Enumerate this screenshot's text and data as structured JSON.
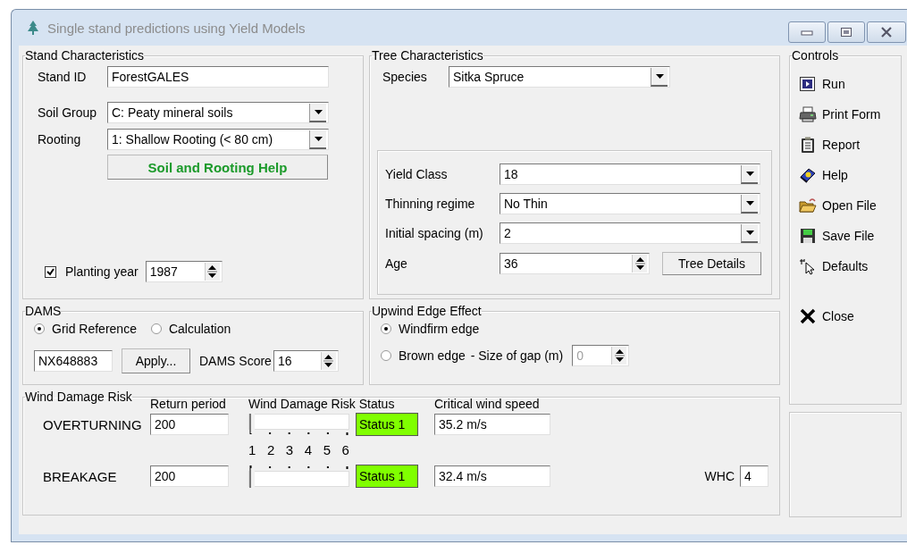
{
  "window": {
    "title": "Single stand predictions using Yield Models"
  },
  "stand_characteristics": {
    "title": "Stand Characteristics",
    "fields": [
      {
        "label": "Stand ID",
        "kind": "text",
        "value": "ForestGALES"
      },
      {
        "label": "Soil Group",
        "kind": "dropdown",
        "value": "C: Peaty mineral soils"
      },
      {
        "label": "Rooting",
        "kind": "dropdown",
        "value": "1: Shallow Rooting (< 80 cm)"
      }
    ],
    "help_button": "Soil and Rooting Help",
    "planting_year": {
      "label": "Planting year",
      "checked": true,
      "value": "1987"
    }
  },
  "tree_characteristics": {
    "title": "Tree Characteristics",
    "species": {
      "label": "Species",
      "value": "Sitka Spruce"
    },
    "fields": [
      {
        "label": "Yield Class",
        "kind": "dropdown",
        "value": "18"
      },
      {
        "label": "Thinning regime",
        "kind": "dropdown",
        "value": "No Thin"
      },
      {
        "label": "Initial spacing (m)",
        "kind": "dropdown",
        "value": "2"
      },
      {
        "label": "Age",
        "kind": "spinner",
        "value": "36"
      }
    ],
    "details_button": "Tree Details"
  },
  "dams": {
    "title": "DAMS",
    "options": [
      {
        "label": "Grid Reference",
        "selected": true
      },
      {
        "label": "Calculation",
        "selected": false
      }
    ],
    "grid_reference": "NX648883",
    "apply_button": "Apply...",
    "score": {
      "label": "DAMS Score",
      "value": "16"
    }
  },
  "upwind_edge_effect": {
    "title": "Upwind Edge Effect",
    "options": [
      {
        "label": "Windfirm edge",
        "selected": true
      },
      {
        "label": "Brown edge",
        "selected": false
      }
    ],
    "gap": {
      "label": "- Size of gap (m)",
      "value": "0",
      "disabled": true
    }
  },
  "wind_damage_risk": {
    "title": "Wind Damage Risk",
    "headers": [
      "Return period",
      "Wind  Damage Risk Status",
      "Critical wind speed"
    ],
    "scale": [
      "1",
      "2",
      "3",
      "4",
      "5",
      "6"
    ],
    "rows": [
      {
        "label": "OVERTURNING",
        "return_period": "200",
        "level": 0,
        "status": "Status 1",
        "color": "#80ff00",
        "critical_wind_speed": "35.2 m/s"
      },
      {
        "label": "BREAKAGE",
        "return_period": "200",
        "level": 0,
        "status": "Status 1",
        "color": "#80ff00",
        "critical_wind_speed": "32.4 m/s"
      }
    ],
    "whc": {
      "label": "WHC",
      "value": "4"
    }
  },
  "controls": {
    "title": "Controls",
    "buttons": [
      {
        "label": "Run",
        "kind": "run"
      },
      {
        "label": "Print Form",
        "kind": "print"
      },
      {
        "label": "Report",
        "kind": "report"
      },
      {
        "label": "Help",
        "kind": "help"
      },
      {
        "label": "Open File",
        "kind": "open"
      },
      {
        "label": "Save File",
        "kind": "save"
      },
      {
        "label": "Defaults",
        "kind": "defaults"
      },
      {
        "label": "Close",
        "kind": "close"
      }
    ]
  }
}
